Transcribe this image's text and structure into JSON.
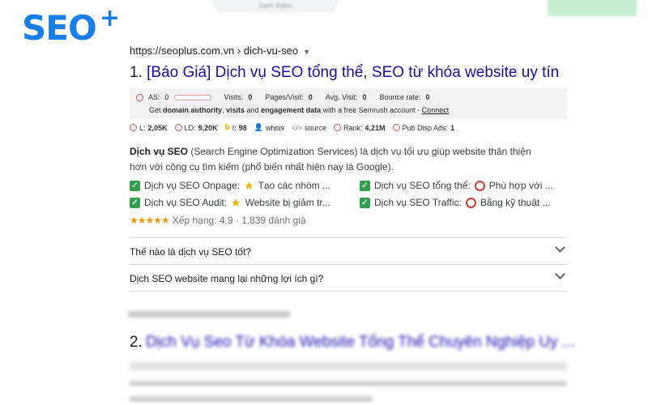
{
  "brand": {
    "logo_text": "SEO",
    "logo_plus": "+"
  },
  "top_bar": {
    "pill_text": "Xem thêm"
  },
  "result1": {
    "url": "https://seoplus.com.vn › dich-vu-seo",
    "number": "1.",
    "title": "[Báo Giá] Dịch vụ SEO tổng thể, SEO từ khóa website uy tín",
    "semrush": {
      "as_label": "AS:",
      "as_value": "0",
      "visits_label": "Visits:",
      "visits_value": "0",
      "pages_label": "Pages/Visit:",
      "pages_value": "0",
      "avg_label": "Avg. Visit:",
      "avg_value": "0",
      "bounce_label": "Bounce rate:",
      "bounce_value": "0",
      "get_text_1": "Get ",
      "get_bold_1": "domain authority",
      "get_text_2": ", ",
      "get_bold_2": "visits",
      "get_text_3": " and ",
      "get_bold_3": "engagement data",
      "get_text_4": " with a free Semrush account - ",
      "connect": "Connect"
    },
    "metrics": {
      "l_label": "L:",
      "l_value": "2,05K",
      "ld_label": "LD:",
      "ld_value": "9,20K",
      "i_label": "I:",
      "i_value": "98",
      "whois": "whois",
      "source": "source",
      "rank_label": "Rank:",
      "rank_value": "4,21M",
      "pub_label": "Pub Disp Ads:",
      "pub_value": "1"
    },
    "description_bold": "Dịch vụ SEO",
    "description_rest": " (Search Engine Optimization Services) là dịch vụ tối ưu giúp website thân thiện hơn với công cụ tìm kiếm (phổ biến nhất hiện nay là Google).",
    "features": [
      {
        "label": "Dịch vụ SEO Onpage:",
        "value": "Tạo các nhóm ..."
      },
      {
        "label": "Dịch vụ SEO tổng thể:",
        "value": "Phù hợp với ..."
      },
      {
        "label": "Dịch vụ SEO Audit:",
        "value": "Website bị giảm tr..."
      },
      {
        "label": "Dịch vụ SEO Traffic:",
        "value": "Bằng kỹ thuật ..."
      }
    ],
    "rating": {
      "stars": "★★★★★",
      "text": "Xếp hạng: 4,9 · 1.839 đánh giá",
      "value": 4.9
    },
    "faq": [
      "Thế nào là dịch vụ SEO tốt?",
      "Dịch SEO website mang lại những lợi ích gì?"
    ]
  },
  "result2": {
    "number": "2.",
    "title": "Dịch Vụ Seo Từ Khóa Website Tổng Thể Chuyên Nghiệp Uy ..."
  },
  "colors": {
    "link": "#1a0dab",
    "logo": "#1a7ee6",
    "check": "#2fa14a",
    "star": "#f2b400",
    "ring": "#d8372b"
  },
  "icons": [
    "check-icon",
    "star-icon",
    "ring-icon",
    "chevron-down-icon",
    "dropdown-arrow-icon",
    "person-icon",
    "code-icon",
    "bing-icon"
  ]
}
